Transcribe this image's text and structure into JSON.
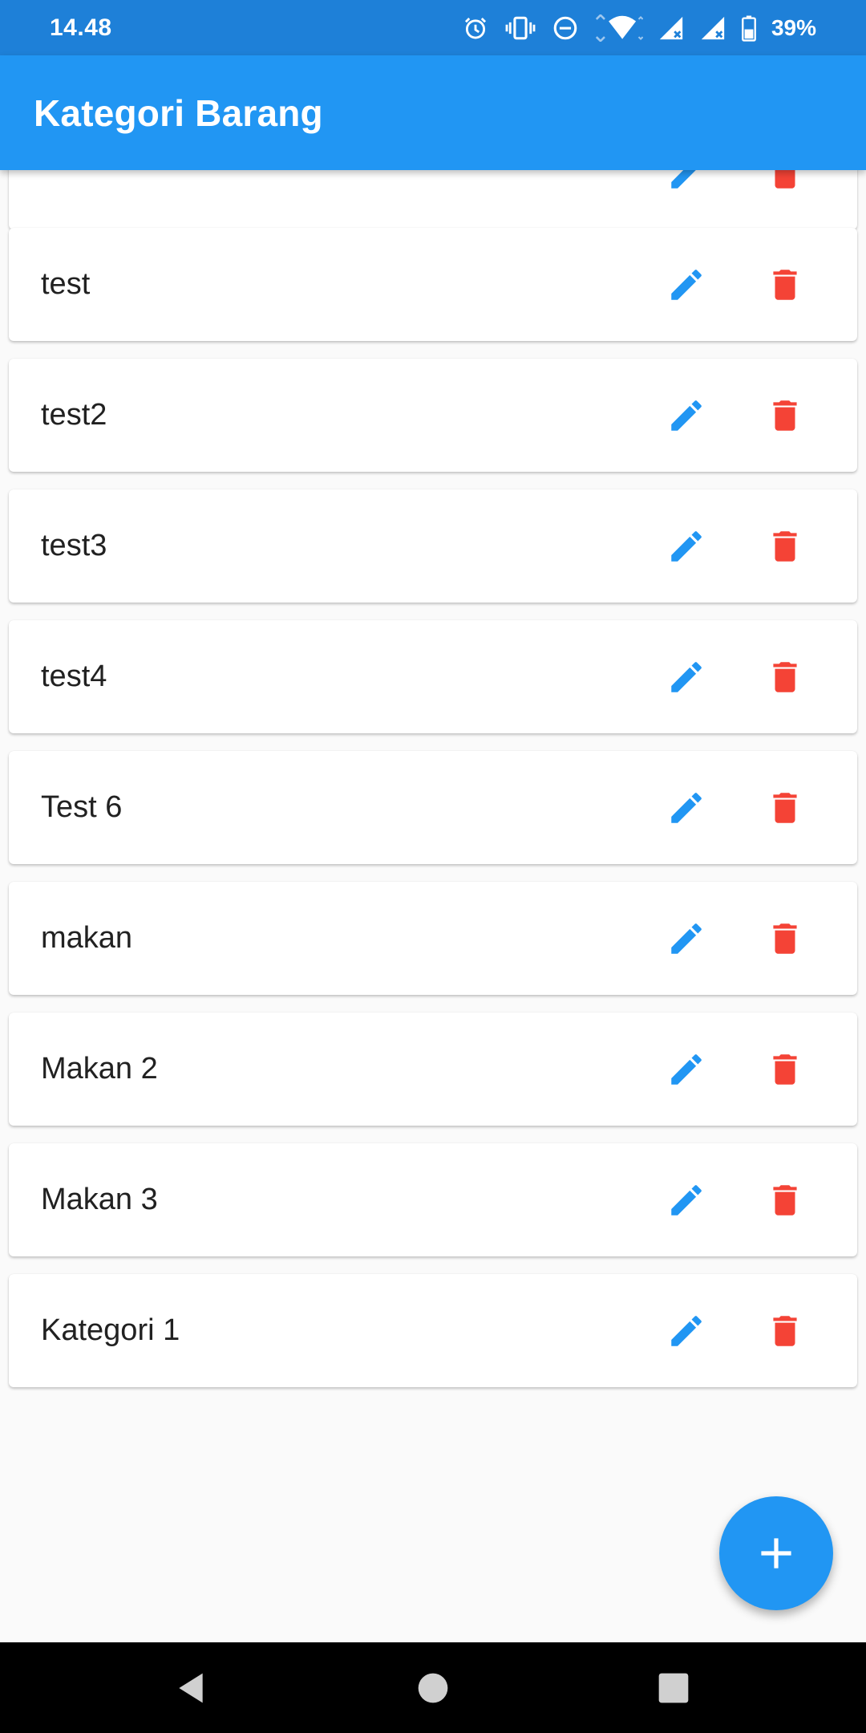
{
  "status_bar": {
    "time": "14.48",
    "battery": "39%",
    "icons": [
      "alarm-icon",
      "vibrate-icon",
      "do-not-disturb-icon",
      "wifi-icon",
      "signal-icon",
      "signal-icon",
      "battery-icon"
    ]
  },
  "app_bar": {
    "title": "Kategori Barang"
  },
  "categories": [
    {
      "label": ""
    },
    {
      "label": "test"
    },
    {
      "label": "test2"
    },
    {
      "label": "test3"
    },
    {
      "label": "test4"
    },
    {
      "label": "Test 6"
    },
    {
      "label": "makan"
    },
    {
      "label": "Makan 2"
    },
    {
      "label": "Makan 3"
    },
    {
      "label": "Kategori 1"
    }
  ],
  "actions": {
    "edit_icon": "pencil-icon",
    "delete_icon": "trash-icon"
  },
  "fab": {
    "icon": "plus-icon"
  },
  "nav_bar": {
    "items": [
      "back-icon",
      "home-icon",
      "recents-icon"
    ]
  },
  "colors": {
    "primary": "#2196f3",
    "status_bar": "#1e80d8",
    "delete": "#f44336",
    "background": "#fafafa"
  }
}
